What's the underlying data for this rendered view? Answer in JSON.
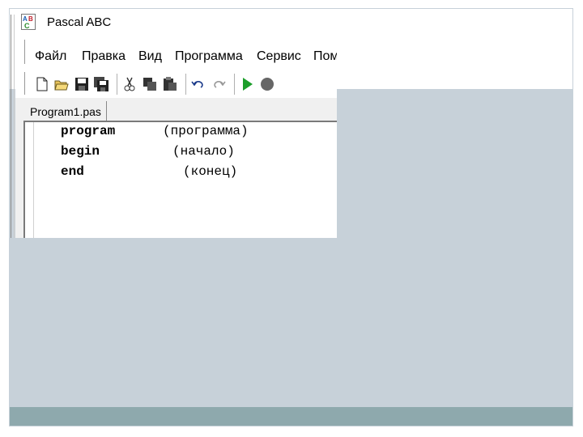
{
  "app": {
    "title": "Pascal ABC",
    "menu": [
      "Файл",
      "Правка",
      "Вид",
      "Программа",
      "Сервис",
      "Пом"
    ],
    "toolbar": [
      "new-file",
      "open-folder",
      "save",
      "save-all",
      "cut",
      "copy",
      "paste",
      "undo",
      "redo",
      "run",
      "stop"
    ],
    "tab": "Program1.pas"
  },
  "code": [
    {
      "keyword": "program",
      "comment": "(программа)"
    },
    {
      "keyword": "begin",
      "comment": "(начало)"
    },
    {
      "keyword": "end",
      "comment": "(конец)"
    }
  ],
  "colors": {
    "slide_body": "#c7d1d9",
    "slide_footer": "#8ea9ad",
    "run_green": "#1c9e2a"
  }
}
